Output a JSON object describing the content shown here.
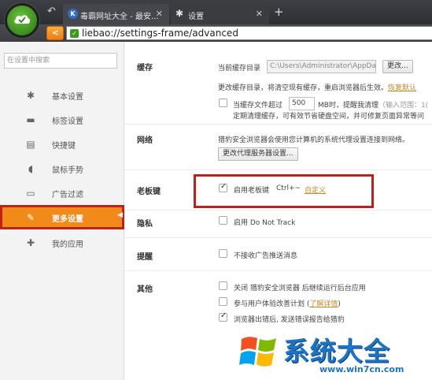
{
  "browser": {
    "tabs": [
      {
        "title": "毒霸网址大全 - 最安...",
        "icon": "k-logo-icon"
      },
      {
        "title": "设置",
        "icon": "gear-icon"
      }
    ],
    "address": "liebao://settings-frame/advanced"
  },
  "sidebar": {
    "search_placeholder": "在设置中搜索",
    "items": [
      {
        "label": "基本设置",
        "icon": "gear-icon"
      },
      {
        "label": "标签设置",
        "icon": "tab-icon"
      },
      {
        "label": "快捷键",
        "icon": "keyboard-icon"
      },
      {
        "label": "鼠标手势",
        "icon": "mouse-icon"
      },
      {
        "label": "广告过滤",
        "icon": "filter-icon"
      },
      {
        "label": "更多设置",
        "icon": "wrench-icon",
        "active": true
      },
      {
        "label": "我的应用",
        "icon": "puzzle-icon"
      }
    ]
  },
  "sections": {
    "cache": {
      "title": "缓存",
      "dir_label": "当前缓存目录",
      "dir_value": "C:\\Users\\Administrator\\AppData\\",
      "change_btn": "更改...",
      "hint": "更改缓存目录，将清空现有缓存，重启浏览器后生效。",
      "restore_link": "恢复默认",
      "limit_label_1": "当缓存文件超过",
      "limit_value": "500",
      "limit_label_2": "MB时，提醒我清理",
      "limit_range": "（输入范围：1(",
      "limit_hint": "定期清理缓存，可有效节省硬盘空间，并可修复页面异常等问"
    },
    "network": {
      "title": "网络",
      "desc": "猎豹安全浏览器会使用您计算机的系统代理设置连接到网络。",
      "proxy_btn": "更改代理服务器设置..."
    },
    "boss_key": {
      "title": "老板键",
      "checkbox_label": "启用老板键",
      "shortcut": "Ctrl+~",
      "customize_link": "自定义",
      "checked": true
    },
    "privacy": {
      "title": "隐私",
      "checkbox_label": "启用 Do Not Track",
      "checked": false
    },
    "reminder": {
      "title": "提醒",
      "checkbox_label": "不接收广告推送消息",
      "checked": false
    },
    "other": {
      "title": "其他",
      "options": [
        {
          "label": "关闭 猎豹安全浏览器 后继续运行后台应用",
          "checked": false
        },
        {
          "label": "参与用户体验改善计划",
          "link": "了解详情",
          "checked": false
        },
        {
          "label": "浏览器出错后, 发送错误报告给猎豹",
          "checked": true
        }
      ]
    }
  },
  "watermark": {
    "title": "系统大全",
    "url": "www.win7cn.com"
  },
  "colors": {
    "active_nav": "#f28a1a",
    "highlight_border": "#c0201c",
    "link": "#c28a2a",
    "watermark_blue": "#1c74c9"
  }
}
